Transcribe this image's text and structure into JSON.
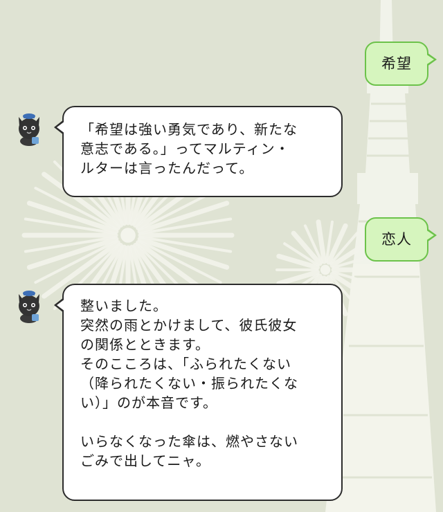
{
  "chat": {
    "messages": [
      {
        "id": "m1",
        "direction": "outgoing",
        "lines": [
          "希望"
        ]
      },
      {
        "id": "m2",
        "direction": "incoming",
        "avatar_icon": "black-cat-mascot-icon",
        "lines": [
          "「希望は強い勇気であり、新たな",
          "意志である。」ってマルティン・",
          "ルターは言ったんだって。"
        ]
      },
      {
        "id": "m3",
        "direction": "outgoing",
        "lines": [
          "恋人"
        ]
      },
      {
        "id": "m4",
        "direction": "incoming",
        "avatar_icon": "black-cat-mascot-icon",
        "lines": [
          "整いました。",
          "突然の雨とかけまして、彼氏彼女",
          "の関係とときます。",
          "そのこころは、「ふられたくない",
          "（降られたくない・振られたくな",
          "い）」のが本音です。",
          "",
          "いらなくなった傘は、燃やさない",
          "ごみで出してニャ。"
        ]
      }
    ]
  },
  "theme": {
    "background": "#dfe3d3",
    "wallpaper_motif": "tower-and-fireworks",
    "incoming_bubble": "#ffffff",
    "outgoing_bubble": "#d6f5be",
    "outgoing_border": "#6cc24a"
  }
}
